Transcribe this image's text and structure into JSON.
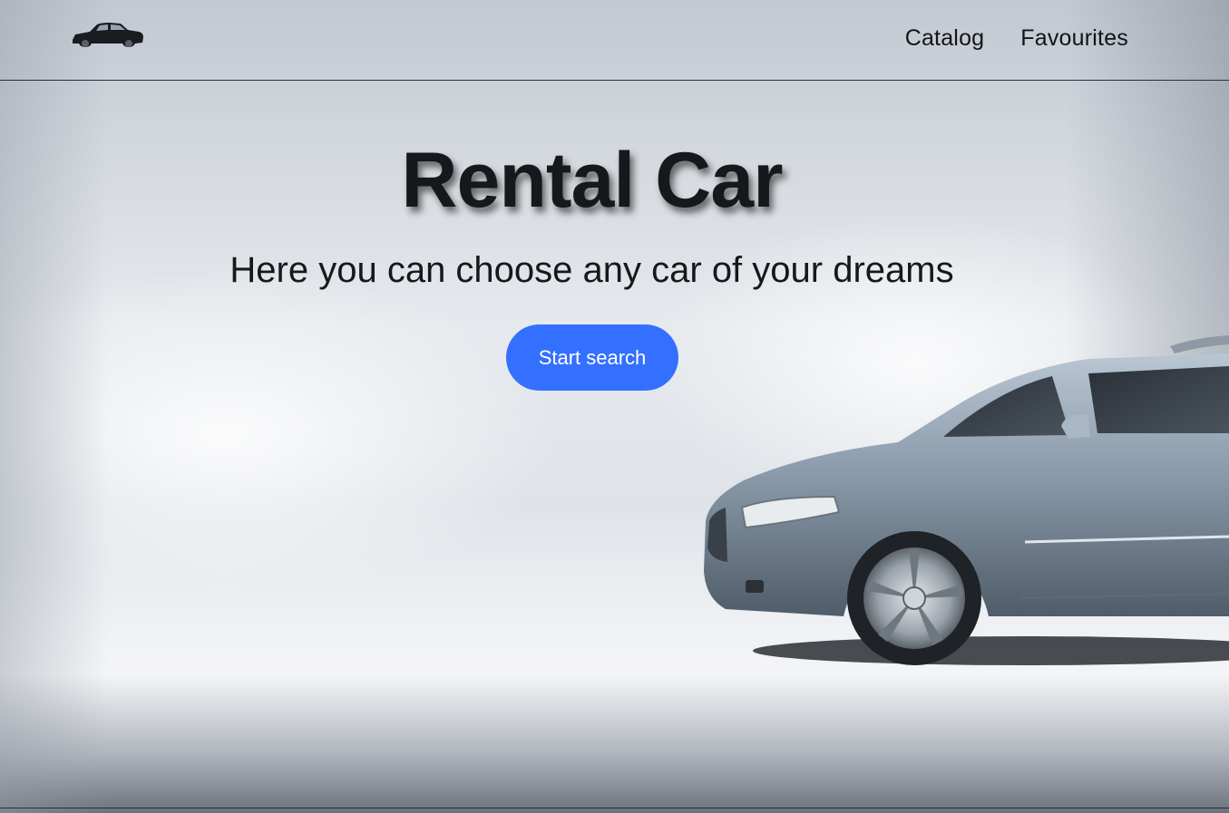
{
  "header": {
    "logo_icon": "car-logo-icon",
    "nav": {
      "catalog": "Catalog",
      "favourites": "Favourites"
    }
  },
  "hero": {
    "title": "Rental Car",
    "subtitle": "Here you can choose any car of your dreams",
    "cta_label": "Start search"
  },
  "colors": {
    "accent": "#3470ff",
    "text": "#121417"
  }
}
